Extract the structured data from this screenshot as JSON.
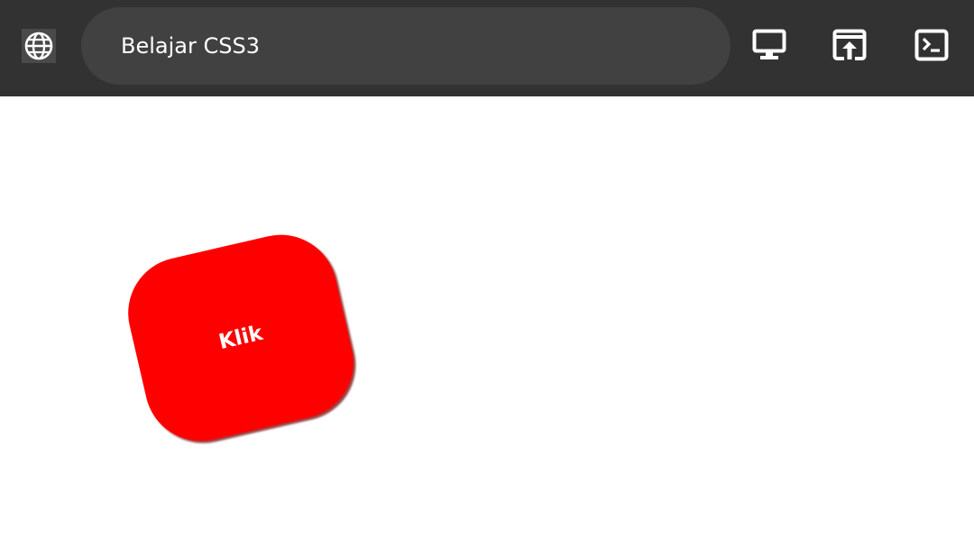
{
  "toolbar": {
    "address_text": "Belajar CSS3",
    "site_icon": "globe-icon",
    "buttons": [
      {
        "icon": "monitor-icon"
      },
      {
        "icon": "open-in-browser-icon"
      },
      {
        "icon": "terminal-icon"
      }
    ],
    "colors": {
      "bar_background": "#323232",
      "pill_background": "#414141",
      "icon": "#ffffff"
    }
  },
  "main": {
    "button_label": "Klik",
    "button_color": "#ff0000"
  }
}
